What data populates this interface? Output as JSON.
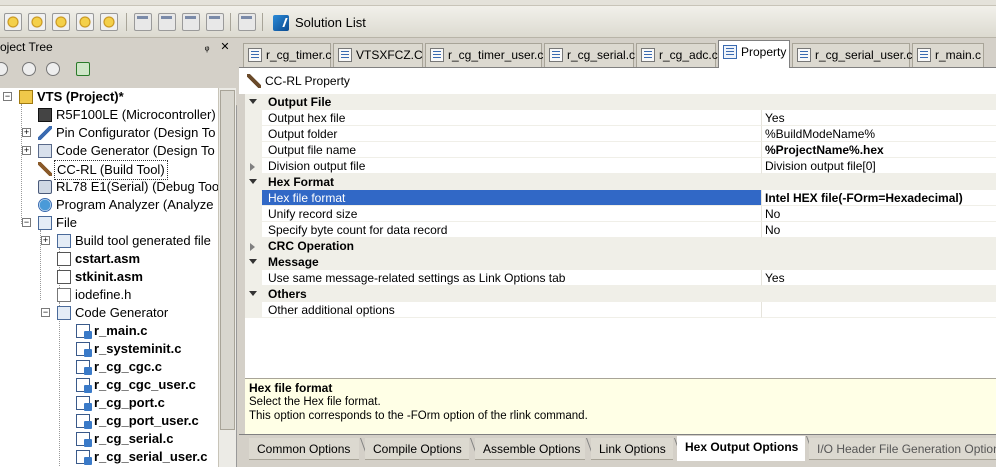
{
  "toolbar": {
    "solution_list_label": "Solution List"
  },
  "project_tree": {
    "panel_title": "roject Tree",
    "pin_glyph": "ᵩ",
    "close_glyph": "✕",
    "items": [
      {
        "label": "VTS (Project)*",
        "icon": "project-icon",
        "bold": true
      },
      {
        "label": "R5F100LE (Microcontroller)",
        "icon": "chip-icon"
      },
      {
        "label": "Pin Configurator (Design To",
        "icon": "pin-icon"
      },
      {
        "label": "Code Generator (Design To",
        "icon": "code-generator-icon"
      },
      {
        "label": "CC-RL (Build Tool)",
        "icon": "build-tool-icon",
        "selected": true
      },
      {
        "label": "RL78 E1(Serial) (Debug Too",
        "icon": "debug-tool-icon"
      },
      {
        "label": "Program Analyzer (Analyze",
        "icon": "analyzer-icon"
      },
      {
        "label": "File",
        "icon": "folder-icon"
      },
      {
        "label": "Build tool generated file",
        "icon": "folder-icon"
      },
      {
        "label": "cstart.asm",
        "icon": "asm-file-icon",
        "bold": true
      },
      {
        "label": "stkinit.asm",
        "icon": "asm-file-icon",
        "bold": true
      },
      {
        "label": "iodefine.h",
        "icon": "header-file-icon"
      },
      {
        "label": "Code Generator",
        "icon": "folder-icon"
      },
      {
        "label": "r_main.c",
        "icon": "c-file-icon",
        "bold": true
      },
      {
        "label": "r_systeminit.c",
        "icon": "c-file-icon",
        "bold": true
      },
      {
        "label": "r_cg_cgc.c",
        "icon": "c-file-icon",
        "bold": true
      },
      {
        "label": "r_cg_cgc_user.c",
        "icon": "c-file-icon",
        "bold": true
      },
      {
        "label": "r_cg_port.c",
        "icon": "c-file-icon",
        "bold": true
      },
      {
        "label": "r_cg_port_user.c",
        "icon": "c-file-icon",
        "bold": true
      },
      {
        "label": "r_cg_serial.c",
        "icon": "c-file-icon",
        "bold": true
      },
      {
        "label": "r_cg_serial_user.c",
        "icon": "c-file-icon",
        "bold": true
      }
    ]
  },
  "doc_tabs": [
    {
      "label": "r_cg_timer.c",
      "active": false
    },
    {
      "label": "VTSXFCZ.C",
      "active": false
    },
    {
      "label": "r_cg_timer_user.c",
      "active": false
    },
    {
      "label": "r_cg_serial.c",
      "active": false
    },
    {
      "label": "r_cg_adc.c",
      "active": false
    },
    {
      "label": "Property",
      "active": true
    },
    {
      "label": "r_cg_serial_user.c",
      "active": false
    },
    {
      "label": "r_main.c",
      "active": false
    }
  ],
  "property": {
    "header": "CC-RL Property",
    "rows": [
      {
        "type": "category",
        "name": "Output File",
        "expanded": true
      },
      {
        "type": "prop",
        "name": "Output hex file",
        "value": "Yes"
      },
      {
        "type": "prop",
        "name": "Output folder",
        "value": "%BuildModeName%"
      },
      {
        "type": "prop",
        "name": "Output file name",
        "value": "%ProjectName%.hex",
        "bold": true
      },
      {
        "type": "prop-collapsed",
        "name": "Division output file",
        "value": "Division output file[0]"
      },
      {
        "type": "category",
        "name": "Hex Format",
        "expanded": true
      },
      {
        "type": "prop",
        "name": "Hex file format",
        "value": "Intel HEX file(-FOrm=Hexadecimal)",
        "bold": true,
        "selected": true
      },
      {
        "type": "prop",
        "name": "Unify record size",
        "value": "No"
      },
      {
        "type": "prop",
        "name": "Specify byte count for data record",
        "value": "No"
      },
      {
        "type": "category",
        "name": "CRC Operation",
        "expanded": false
      },
      {
        "type": "category",
        "name": "Message",
        "expanded": true
      },
      {
        "type": "prop",
        "name": "Use same message-related settings as Link Options tab",
        "value": "Yes"
      },
      {
        "type": "category",
        "name": "Others",
        "expanded": true
      },
      {
        "type": "prop",
        "name": "Other additional options",
        "value": ""
      }
    ],
    "description": {
      "title": "Hex file format",
      "line1": "Select the Hex file format.",
      "line2": "This option corresponds to the -FOrm option of the rlink command."
    }
  },
  "bottom_tabs": [
    {
      "label": "Common Options",
      "active": false
    },
    {
      "label": "Compile Options",
      "active": false
    },
    {
      "label": "Assemble Options",
      "active": false
    },
    {
      "label": "Link Options",
      "active": false
    },
    {
      "label": "Hex Output Options",
      "active": true
    },
    {
      "label": "I/O Header File Generation Options",
      "active": false
    }
  ]
}
